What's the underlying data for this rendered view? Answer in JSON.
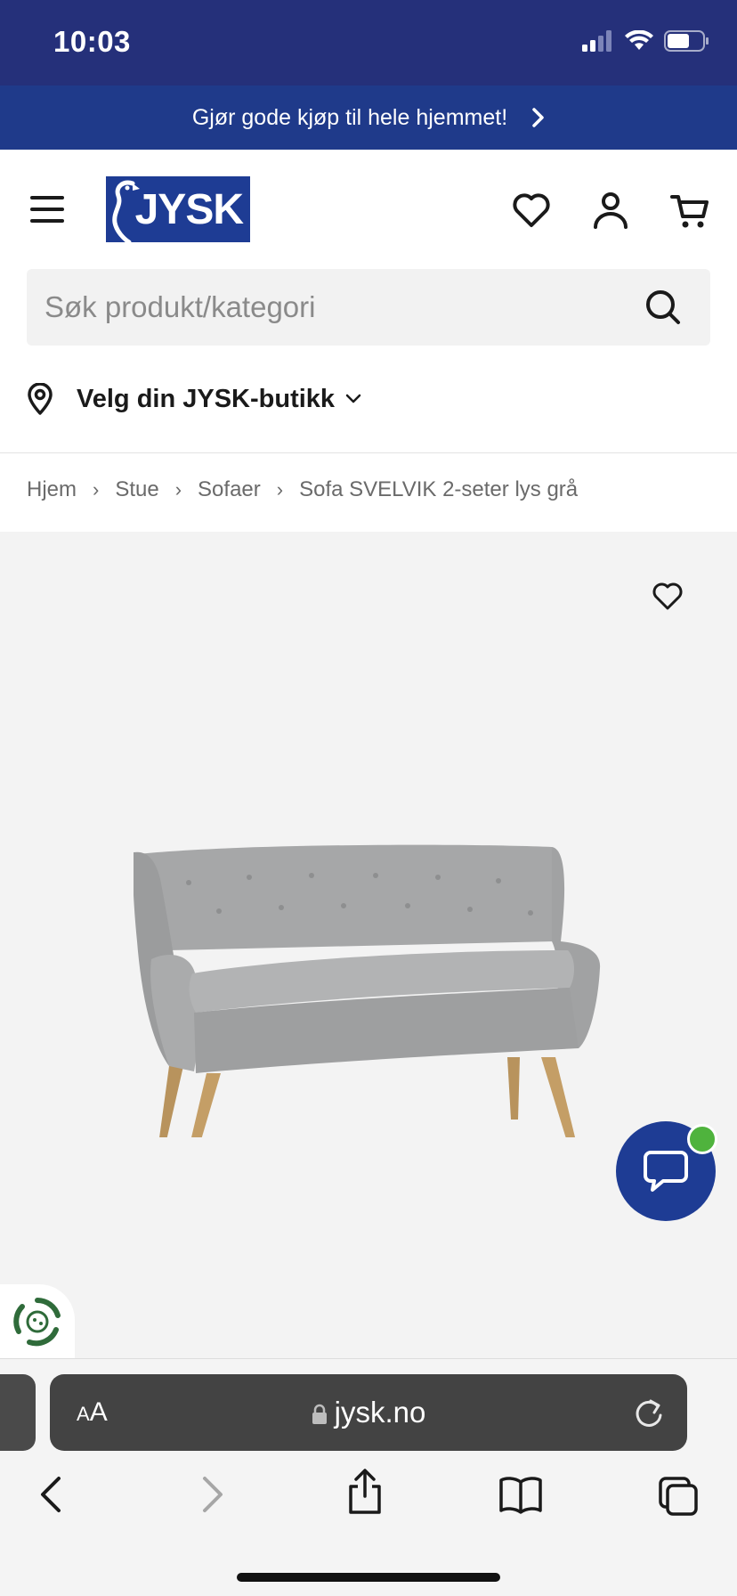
{
  "status_bar": {
    "time": "10:03"
  },
  "promo": {
    "text": "Gjør gode kjøp til hele hjemmet!"
  },
  "header": {
    "logo_text": "JYSK"
  },
  "search": {
    "placeholder": "Søk produkt/kategori"
  },
  "store": {
    "label": "Velg din JYSK-butikk"
  },
  "breadcrumb": [
    "Hjem",
    "Stue",
    "Sofaer",
    "Sofa SVELVIK 2-seter lys grå"
  ],
  "browser": {
    "aa_small": "A",
    "aa_large": "A",
    "url": "jysk.no"
  },
  "colors": {
    "brand_blue": "#1e3c94",
    "status_bar": "#25307a",
    "chat_online": "#4fb33d"
  },
  "icons": {
    "menu": "menu-icon",
    "wishlist": "heart-icon",
    "account": "user-icon",
    "cart": "cart-icon",
    "search": "search-icon",
    "location": "location-pin-icon",
    "chevron": "chevron-down-icon",
    "chat": "chat-bubble-icon",
    "eco": "recycle-icon"
  }
}
